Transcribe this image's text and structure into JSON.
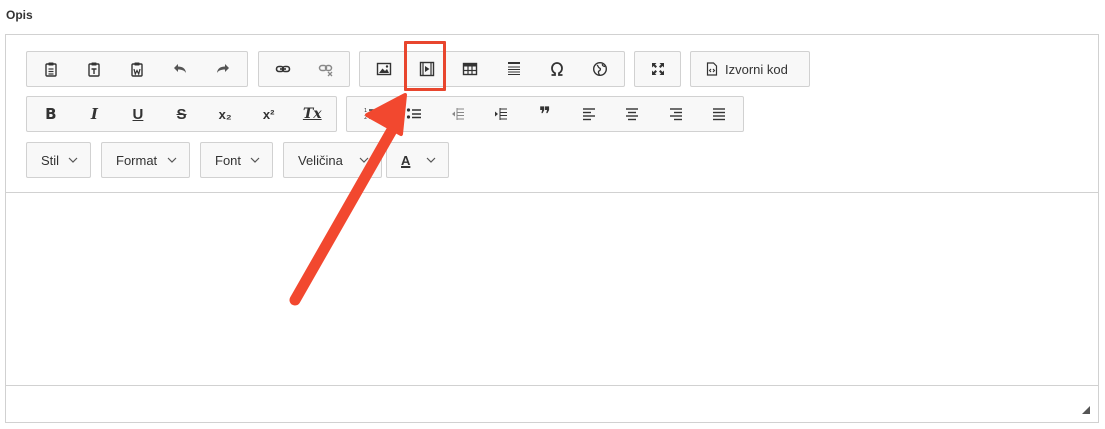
{
  "field": {
    "label": "Opis"
  },
  "toolbar": {
    "row1": {
      "clipboard": [
        {
          "name": "paste-icon",
          "title": "Paste"
        },
        {
          "name": "paste-text-icon",
          "title": "Paste as plain text"
        },
        {
          "name": "paste-word-icon",
          "title": "Paste from Word"
        },
        {
          "name": "undo-icon",
          "title": "Undo"
        },
        {
          "name": "redo-icon",
          "title": "Redo"
        }
      ],
      "links": [
        {
          "name": "link-icon",
          "title": "Link"
        },
        {
          "name": "unlink-icon",
          "title": "Unlink"
        }
      ],
      "insert": [
        {
          "name": "image-icon",
          "title": "Image"
        },
        {
          "name": "video-icon",
          "title": "Video"
        },
        {
          "name": "table-icon",
          "title": "Table"
        },
        {
          "name": "horizontal-line-icon",
          "title": "Horizontal line"
        },
        {
          "name": "special-char-icon",
          "title": "Special character"
        },
        {
          "name": "iframe-globe-icon",
          "title": "IFrame"
        }
      ],
      "maximize": {
        "name": "maximize-icon",
        "title": "Maximize"
      },
      "source": {
        "label": "Izvorni kod"
      }
    },
    "row2": {
      "basic": [
        {
          "name": "bold-icon",
          "glyph": "B"
        },
        {
          "name": "italic-icon",
          "glyph": "I"
        },
        {
          "name": "underline-icon",
          "glyph": "U"
        },
        {
          "name": "strike-icon",
          "glyph": "S"
        },
        {
          "name": "subscript-icon",
          "glyph": "x₂"
        },
        {
          "name": "superscript-icon",
          "glyph": "x²"
        },
        {
          "name": "remove-format-icon",
          "glyph": "Tx"
        }
      ],
      "paragraph": [
        {
          "name": "numbered-list-icon"
        },
        {
          "name": "bulleted-list-icon"
        },
        {
          "name": "outdent-icon"
        },
        {
          "name": "indent-icon"
        },
        {
          "name": "blockquote-icon",
          "glyph": "❞"
        },
        {
          "name": "align-left-icon"
        },
        {
          "name": "align-center-icon"
        },
        {
          "name": "align-right-icon"
        },
        {
          "name": "justify-icon"
        }
      ]
    },
    "row3": {
      "style": "Stil",
      "format": "Format",
      "font": "Font",
      "size": "Veličina",
      "text_color": "A"
    }
  },
  "colors": {
    "accent": "#e8462e",
    "border": "#d1d1d1",
    "toolbar_bg": "#f8f8f8"
  }
}
